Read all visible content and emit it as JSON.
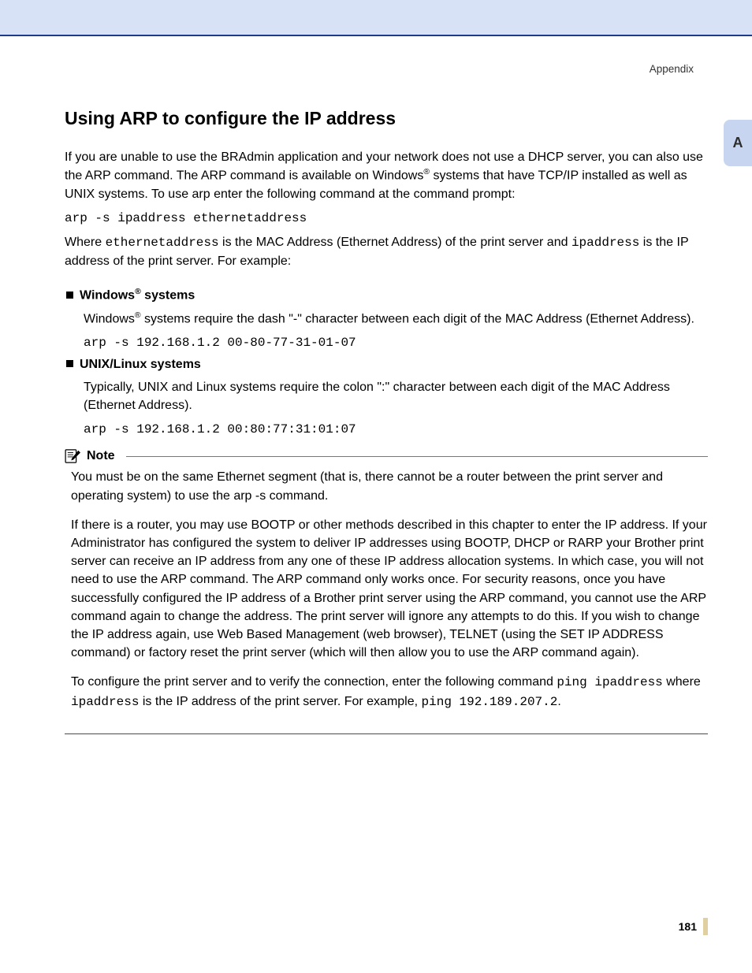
{
  "header": {
    "breadcrumb": "Appendix",
    "sidetab": "A"
  },
  "title": "Using ARP to configure the IP address",
  "intro": {
    "p1a": "If you are unable to use the BRAdmin application and your network does not use a DHCP server, you can also use the ARP command. The ARP command is available on Windows",
    "reg1": "®",
    "p1b": " systems that have TCP/IP installed as well as UNIX systems. To use arp enter the following command at the command prompt:",
    "cmd1": "arp -s ipaddress ethernetaddress",
    "p2a": "Where ",
    "code_eth": "ethernetaddress",
    "p2b": " is the MAC Address (Ethernet Address) of the print server and ",
    "code_ip": "ipaddress",
    "p2c": " is the IP address of the print server. For example:"
  },
  "windows": {
    "head_a": "Windows",
    "reg": "®",
    "head_b": " systems",
    "body_a": "Windows",
    "body_b": " systems require the dash \"-\" character between each digit of the MAC Address (Ethernet Address).",
    "cmd": "arp -s 192.168.1.2 00-80-77-31-01-07"
  },
  "unix": {
    "head": "UNIX/Linux systems",
    "body": "Typically, UNIX and Linux systems require the colon \":\" character between each digit of the MAC Address (Ethernet Address).",
    "cmd": "arp -s 192.168.1.2 00:80:77:31:01:07"
  },
  "note": {
    "label": "Note",
    "p1": "You must be on the same Ethernet segment (that is, there cannot be a router between the print server and operating system) to use the arp -s command.",
    "p2": "If there is a router, you may use BOOTP or other methods described in this chapter to enter the IP address. If your Administrator has configured the system to deliver IP addresses using BOOTP, DHCP or RARP your Brother print server can receive an IP address from any one of these IP address allocation systems. In which case, you will not need to use the ARP command. The ARP command only works once. For security reasons, once you have successfully configured the IP address of a Brother print server using the ARP command, you cannot use the ARP command again to change the address. The print server will ignore any attempts to do this. If you wish to change the IP address again, use Web Based Management (web browser), TELNET (using the SET IP ADDRESS command) or factory reset the print server (which will then allow you to use the ARP command again).",
    "p3a": "To configure the print server and to verify the connection, enter the following command ",
    "p3_cmd1": "ping ipaddress",
    "p3b": " where ",
    "p3_cmd2": "ipaddress",
    "p3c": " is the IP address of the print server. For example, ",
    "p3_cmd3": "ping 192.189.207.2",
    "p3d": "."
  },
  "footer": {
    "page": "181"
  }
}
